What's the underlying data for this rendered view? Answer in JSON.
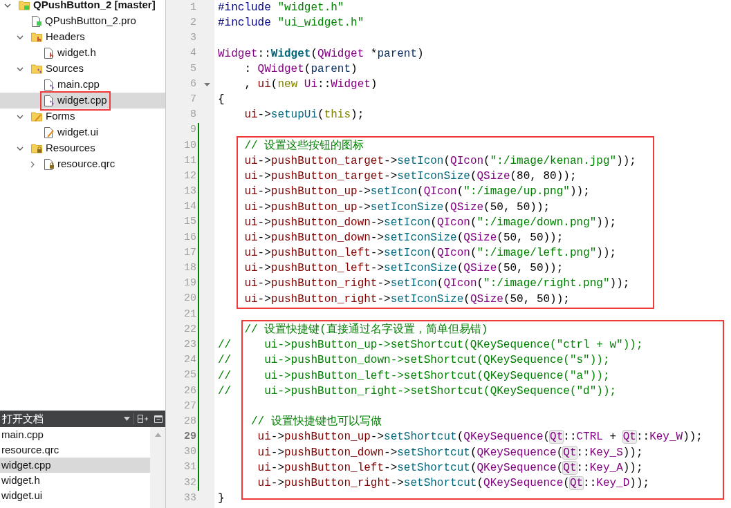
{
  "project_tree": [
    {
      "label": "QPushButton_2 [master]",
      "kind": "project",
      "expanded": true,
      "selected": false,
      "boxed": false,
      "children": [
        {
          "label": "QPushButton_2.pro",
          "kind": "profile",
          "selected": false,
          "boxed": false
        },
        {
          "label": "Headers",
          "kind": "headers",
          "expanded": true,
          "selected": false,
          "boxed": false,
          "children": [
            {
              "label": "widget.h",
              "kind": "header",
              "selected": false,
              "boxed": false
            }
          ]
        },
        {
          "label": "Sources",
          "kind": "sources",
          "expanded": true,
          "selected": false,
          "boxed": false,
          "children": [
            {
              "label": "main.cpp",
              "kind": "source",
              "selected": false,
              "boxed": false
            },
            {
              "label": "widget.cpp",
              "kind": "source",
              "selected": true,
              "boxed": true
            }
          ]
        },
        {
          "label": "Forms",
          "kind": "forms",
          "expanded": true,
          "selected": false,
          "boxed": false,
          "children": [
            {
              "label": "widget.ui",
              "kind": "form",
              "selected": false,
              "boxed": false
            }
          ]
        },
        {
          "label": "Resources",
          "kind": "resources",
          "expanded": true,
          "selected": false,
          "boxed": false,
          "children": [
            {
              "label": "resource.qrc",
              "kind": "resource",
              "expanded": false,
              "selected": false,
              "boxed": false
            }
          ]
        }
      ]
    }
  ],
  "open_documents": {
    "title": "打开文档",
    "items": [
      {
        "label": "main.cpp",
        "selected": false
      },
      {
        "label": "resource.qrc",
        "selected": false
      },
      {
        "label": "widget.cpp",
        "selected": true
      },
      {
        "label": "widget.h",
        "selected": false
      },
      {
        "label": "widget.ui",
        "selected": false
      }
    ]
  },
  "sections": [
    {
      "boxed": false,
      "lines": [
        {
          "number": "1",
          "current": false,
          "modified": false,
          "fold": false,
          "tokens": [
            {
              "kind": "preproc",
              "text": "#include "
            },
            {
              "kind": "string",
              "text": "\"widget.h\""
            }
          ]
        },
        {
          "number": "2",
          "current": false,
          "modified": false,
          "fold": false,
          "tokens": [
            {
              "kind": "preproc",
              "text": "#include "
            },
            {
              "kind": "string",
              "text": "\"ui_widget.h\""
            }
          ]
        },
        {
          "number": "3",
          "current": false,
          "modified": false,
          "fold": false
        },
        {
          "number": "4",
          "current": false,
          "modified": false,
          "fold": false,
          "tokens": [
            {
              "kind": "type",
              "text": "Widget"
            },
            {
              "kind": "plain",
              "text": "::"
            },
            {
              "kind": "funcdef",
              "text": "Widget"
            },
            {
              "kind": "plain",
              "text": "("
            },
            {
              "kind": "type",
              "text": "QWidget"
            },
            {
              "kind": "plain",
              "text": " *"
            },
            {
              "kind": "param",
              "text": "parent"
            },
            {
              "kind": "plain",
              "text": ")"
            }
          ]
        },
        {
          "number": "5",
          "current": false,
          "modified": false,
          "fold": false,
          "tokens": [
            {
              "kind": "plain",
              "text": "    : "
            },
            {
              "kind": "type",
              "text": "QWidget"
            },
            {
              "kind": "plain",
              "text": "("
            },
            {
              "kind": "param",
              "text": "parent"
            },
            {
              "kind": "plain",
              "text": ")"
            }
          ]
        },
        {
          "number": "6",
          "current": false,
          "modified": false,
          "fold": true,
          "tokens": [
            {
              "kind": "plain",
              "text": "    , "
            },
            {
              "kind": "member",
              "text": "ui"
            },
            {
              "kind": "plain",
              "text": "("
            },
            {
              "kind": "keyword",
              "text": "new "
            },
            {
              "kind": "type",
              "text": "Ui"
            },
            {
              "kind": "plain",
              "text": "::"
            },
            {
              "kind": "type",
              "text": "Widget"
            },
            {
              "kind": "plain",
              "text": ")"
            }
          ]
        },
        {
          "number": "7",
          "current": false,
          "modified": false,
          "fold": false,
          "tokens": [
            {
              "kind": "plain",
              "text": "{"
            }
          ]
        },
        {
          "number": "8",
          "current": false,
          "modified": false,
          "fold": false,
          "tokens": [
            {
              "kind": "member",
              "text": "    ui"
            },
            {
              "kind": "plain",
              "text": "->"
            },
            {
              "kind": "func",
              "text": "setupUi"
            },
            {
              "kind": "plain",
              "text": "("
            },
            {
              "kind": "keyword",
              "text": "this"
            },
            {
              "kind": "plain",
              "text": ");"
            }
          ]
        },
        {
          "number": "9",
          "current": false,
          "modified": true,
          "fold": false
        }
      ]
    },
    {
      "boxed": true,
      "lines": [
        {
          "number": "10",
          "current": false,
          "modified": true,
          "fold": false,
          "tokens": [
            {
              "kind": "comment",
              "text": "    // 设置这些按钮的图标"
            }
          ]
        },
        {
          "number": "11",
          "current": false,
          "modified": true,
          "fold": false,
          "tokens": [
            {
              "kind": "member",
              "text": "    ui"
            },
            {
              "kind": "plain",
              "text": "->"
            },
            {
              "kind": "member",
              "text": "pushButton_target"
            },
            {
              "kind": "plain",
              "text": "->"
            },
            {
              "kind": "func",
              "text": "setIcon"
            },
            {
              "kind": "plain",
              "text": "("
            },
            {
              "kind": "type",
              "text": "QIcon"
            },
            {
              "kind": "plain",
              "text": "("
            },
            {
              "kind": "string",
              "text": "\":/image/kenan.jpg\""
            },
            {
              "kind": "plain",
              "text": "));"
            }
          ]
        },
        {
          "number": "12",
          "current": false,
          "modified": true,
          "fold": false,
          "tokens": [
            {
              "kind": "member",
              "text": "    ui"
            },
            {
              "kind": "plain",
              "text": "->"
            },
            {
              "kind": "member",
              "text": "pushButton_target"
            },
            {
              "kind": "plain",
              "text": "->"
            },
            {
              "kind": "func",
              "text": "setIconSize"
            },
            {
              "kind": "plain",
              "text": "("
            },
            {
              "kind": "type",
              "text": "QSize"
            },
            {
              "kind": "plain",
              "text": "(80, 80));"
            }
          ]
        },
        {
          "number": "13",
          "current": false,
          "modified": true,
          "fold": false,
          "tokens": [
            {
              "kind": "member",
              "text": "    ui"
            },
            {
              "kind": "plain",
              "text": "->"
            },
            {
              "kind": "member",
              "text": "pushButton_up"
            },
            {
              "kind": "plain",
              "text": "->"
            },
            {
              "kind": "func",
              "text": "setIcon"
            },
            {
              "kind": "plain",
              "text": "("
            },
            {
              "kind": "type",
              "text": "QIcon"
            },
            {
              "kind": "plain",
              "text": "("
            },
            {
              "kind": "string",
              "text": "\":/image/up.png\""
            },
            {
              "kind": "plain",
              "text": "));"
            }
          ]
        },
        {
          "number": "14",
          "current": false,
          "modified": true,
          "fold": false,
          "tokens": [
            {
              "kind": "member",
              "text": "    ui"
            },
            {
              "kind": "plain",
              "text": "->"
            },
            {
              "kind": "member",
              "text": "pushButton_up"
            },
            {
              "kind": "plain",
              "text": "->"
            },
            {
              "kind": "func",
              "text": "setIconSize"
            },
            {
              "kind": "plain",
              "text": "("
            },
            {
              "kind": "type",
              "text": "QSize"
            },
            {
              "kind": "plain",
              "text": "(50, 50));"
            }
          ]
        },
        {
          "number": "15",
          "current": false,
          "modified": true,
          "fold": false,
          "tokens": [
            {
              "kind": "member",
              "text": "    ui"
            },
            {
              "kind": "plain",
              "text": "->"
            },
            {
              "kind": "member",
              "text": "pushButton_down"
            },
            {
              "kind": "plain",
              "text": "->"
            },
            {
              "kind": "func",
              "text": "setIcon"
            },
            {
              "kind": "plain",
              "text": "("
            },
            {
              "kind": "type",
              "text": "QIcon"
            },
            {
              "kind": "plain",
              "text": "("
            },
            {
              "kind": "string",
              "text": "\":/image/down.png\""
            },
            {
              "kind": "plain",
              "text": "));"
            }
          ]
        },
        {
          "number": "16",
          "current": false,
          "modified": true,
          "fold": false,
          "tokens": [
            {
              "kind": "member",
              "text": "    ui"
            },
            {
              "kind": "plain",
              "text": "->"
            },
            {
              "kind": "member",
              "text": "pushButton_down"
            },
            {
              "kind": "plain",
              "text": "->"
            },
            {
              "kind": "func",
              "text": "setIconSize"
            },
            {
              "kind": "plain",
              "text": "("
            },
            {
              "kind": "type",
              "text": "QSize"
            },
            {
              "kind": "plain",
              "text": "(50, 50));"
            }
          ]
        },
        {
          "number": "17",
          "current": false,
          "modified": true,
          "fold": false,
          "tokens": [
            {
              "kind": "member",
              "text": "    ui"
            },
            {
              "kind": "plain",
              "text": "->"
            },
            {
              "kind": "member",
              "text": "pushButton_left"
            },
            {
              "kind": "plain",
              "text": "->"
            },
            {
              "kind": "func",
              "text": "setIcon"
            },
            {
              "kind": "plain",
              "text": "("
            },
            {
              "kind": "type",
              "text": "QIcon"
            },
            {
              "kind": "plain",
              "text": "("
            },
            {
              "kind": "string",
              "text": "\":/image/left.png\""
            },
            {
              "kind": "plain",
              "text": "));"
            }
          ]
        },
        {
          "number": "18",
          "current": false,
          "modified": true,
          "fold": false,
          "tokens": [
            {
              "kind": "member",
              "text": "    ui"
            },
            {
              "kind": "plain",
              "text": "->"
            },
            {
              "kind": "member",
              "text": "pushButton_left"
            },
            {
              "kind": "plain",
              "text": "->"
            },
            {
              "kind": "func",
              "text": "setIconSize"
            },
            {
              "kind": "plain",
              "text": "("
            },
            {
              "kind": "type",
              "text": "QSize"
            },
            {
              "kind": "plain",
              "text": "(50, 50));"
            }
          ]
        },
        {
          "number": "19",
          "current": false,
          "modified": true,
          "fold": false,
          "tokens": [
            {
              "kind": "member",
              "text": "    ui"
            },
            {
              "kind": "plain",
              "text": "->"
            },
            {
              "kind": "member",
              "text": "pushButton_right"
            },
            {
              "kind": "plain",
              "text": "->"
            },
            {
              "kind": "func",
              "text": "setIcon"
            },
            {
              "kind": "plain",
              "text": "("
            },
            {
              "kind": "type",
              "text": "QIcon"
            },
            {
              "kind": "plain",
              "text": "("
            },
            {
              "kind": "string",
              "text": "\":/image/right.png\""
            },
            {
              "kind": "plain",
              "text": "));"
            }
          ]
        },
        {
          "number": "20",
          "current": false,
          "modified": true,
          "fold": false,
          "tokens": [
            {
              "kind": "member",
              "text": "    ui"
            },
            {
              "kind": "plain",
              "text": "->"
            },
            {
              "kind": "member",
              "text": "pushButton_right"
            },
            {
              "kind": "plain",
              "text": "->"
            },
            {
              "kind": "func",
              "text": "setIconSize"
            },
            {
              "kind": "plain",
              "text": "("
            },
            {
              "kind": "type",
              "text": "QSize"
            },
            {
              "kind": "plain",
              "text": "(50, 50));"
            }
          ]
        }
      ]
    },
    {
      "boxed": false,
      "lines": [
        {
          "number": "21",
          "current": false,
          "modified": true,
          "fold": false
        }
      ]
    },
    {
      "boxed": true,
      "lines": [
        {
          "number": "22",
          "current": false,
          "modified": true,
          "fold": false,
          "tokens": [
            {
              "kind": "comment",
              "text": "    // 设置快捷键(直接通过名字设置，简单但易错)"
            }
          ]
        },
        {
          "number": "23",
          "current": false,
          "modified": true,
          "fold": false,
          "tokens": [
            {
              "kind": "comment",
              "text": "//     ui->pushButton_up->setShortcut(QKeySequence(\"ctrl + w\"));"
            }
          ]
        },
        {
          "number": "24",
          "current": false,
          "modified": true,
          "fold": false,
          "tokens": [
            {
              "kind": "comment",
              "text": "//     ui->pushButton_down->setShortcut(QKeySequence(\"s\"));"
            }
          ]
        },
        {
          "number": "25",
          "current": false,
          "modified": true,
          "fold": false,
          "tokens": [
            {
              "kind": "comment",
              "text": "//     ui->pushButton_left->setShortcut(QKeySequence(\"a\"));"
            }
          ]
        },
        {
          "number": "26",
          "current": false,
          "modified": true,
          "fold": false,
          "tokens": [
            {
              "kind": "comment",
              "text": "//     ui->pushButton_right->setShortcut(QKeySequence(\"d\"));"
            }
          ]
        },
        {
          "number": "27",
          "current": false,
          "modified": true,
          "fold": false
        },
        {
          "number": "28",
          "current": false,
          "modified": true,
          "fold": false,
          "tokens": [
            {
              "kind": "comment",
              "text": "     // 设置快捷键也可以写做"
            }
          ]
        },
        {
          "number": "29",
          "current": true,
          "modified": true,
          "fold": false,
          "tokens": [
            {
              "kind": "member",
              "text": "      ui"
            },
            {
              "kind": "plain",
              "text": "->"
            },
            {
              "kind": "member",
              "text": "pushButton_up"
            },
            {
              "kind": "plain",
              "text": "->"
            },
            {
              "kind": "func",
              "text": "setShortcut"
            },
            {
              "kind": "plain",
              "text": "("
            },
            {
              "kind": "type",
              "text": "QKeySequence"
            },
            {
              "kind": "plain",
              "text": "("
            },
            {
              "kind": "qt",
              "text": "Qt"
            },
            {
              "kind": "plain",
              "text": "::"
            },
            {
              "kind": "enum",
              "text": "CTRL"
            },
            {
              "kind": "plain",
              "text": " + "
            },
            {
              "kind": "qt",
              "text": "Qt"
            },
            {
              "kind": "plain",
              "text": "::"
            },
            {
              "kind": "enum",
              "text": "Key_W"
            },
            {
              "kind": "plain",
              "text": "));"
            }
          ]
        },
        {
          "number": "30",
          "current": false,
          "modified": true,
          "fold": false,
          "tokens": [
            {
              "kind": "member",
              "text": "      ui"
            },
            {
              "kind": "plain",
              "text": "->"
            },
            {
              "kind": "member",
              "text": "pushButton_down"
            },
            {
              "kind": "plain",
              "text": "->"
            },
            {
              "kind": "func",
              "text": "setShortcut"
            },
            {
              "kind": "plain",
              "text": "("
            },
            {
              "kind": "type",
              "text": "QKeySequence"
            },
            {
              "kind": "plain",
              "text": "("
            },
            {
              "kind": "qt",
              "text": "Qt"
            },
            {
              "kind": "plain",
              "text": "::"
            },
            {
              "kind": "enum",
              "text": "Key_S"
            },
            {
              "kind": "plain",
              "text": "));"
            }
          ]
        },
        {
          "number": "31",
          "current": false,
          "modified": true,
          "fold": false,
          "tokens": [
            {
              "kind": "member",
              "text": "      ui"
            },
            {
              "kind": "plain",
              "text": "->"
            },
            {
              "kind": "member",
              "text": "pushButton_left"
            },
            {
              "kind": "plain",
              "text": "->"
            },
            {
              "kind": "func",
              "text": "setShortcut"
            },
            {
              "kind": "plain",
              "text": "("
            },
            {
              "kind": "type",
              "text": "QKeySequence"
            },
            {
              "kind": "plain",
              "text": "("
            },
            {
              "kind": "qt",
              "text": "Qt"
            },
            {
              "kind": "plain",
              "text": "::"
            },
            {
              "kind": "enum",
              "text": "Key_A"
            },
            {
              "kind": "plain",
              "text": "));"
            }
          ]
        },
        {
          "number": "32",
          "current": false,
          "modified": true,
          "fold": false,
          "tokens": [
            {
              "kind": "member",
              "text": "      ui"
            },
            {
              "kind": "plain",
              "text": "->"
            },
            {
              "kind": "member",
              "text": "pushButton_right"
            },
            {
              "kind": "plain",
              "text": "->"
            },
            {
              "kind": "func",
              "text": "setShortcut"
            },
            {
              "kind": "plain",
              "text": "("
            },
            {
              "kind": "type",
              "text": "QKeySequence"
            },
            {
              "kind": "plain",
              "text": "("
            },
            {
              "kind": "qt",
              "text": "Qt"
            },
            {
              "kind": "plain",
              "text": "::"
            },
            {
              "kind": "enum",
              "text": "Key_D"
            },
            {
              "kind": "plain",
              "text": "));"
            }
          ]
        }
      ]
    },
    {
      "boxed": false,
      "lines": [
        {
          "number": "33",
          "current": false,
          "modified": false,
          "fold": false,
          "tokens": [
            {
              "kind": "plain",
              "text": "}"
            }
          ]
        }
      ]
    }
  ]
}
